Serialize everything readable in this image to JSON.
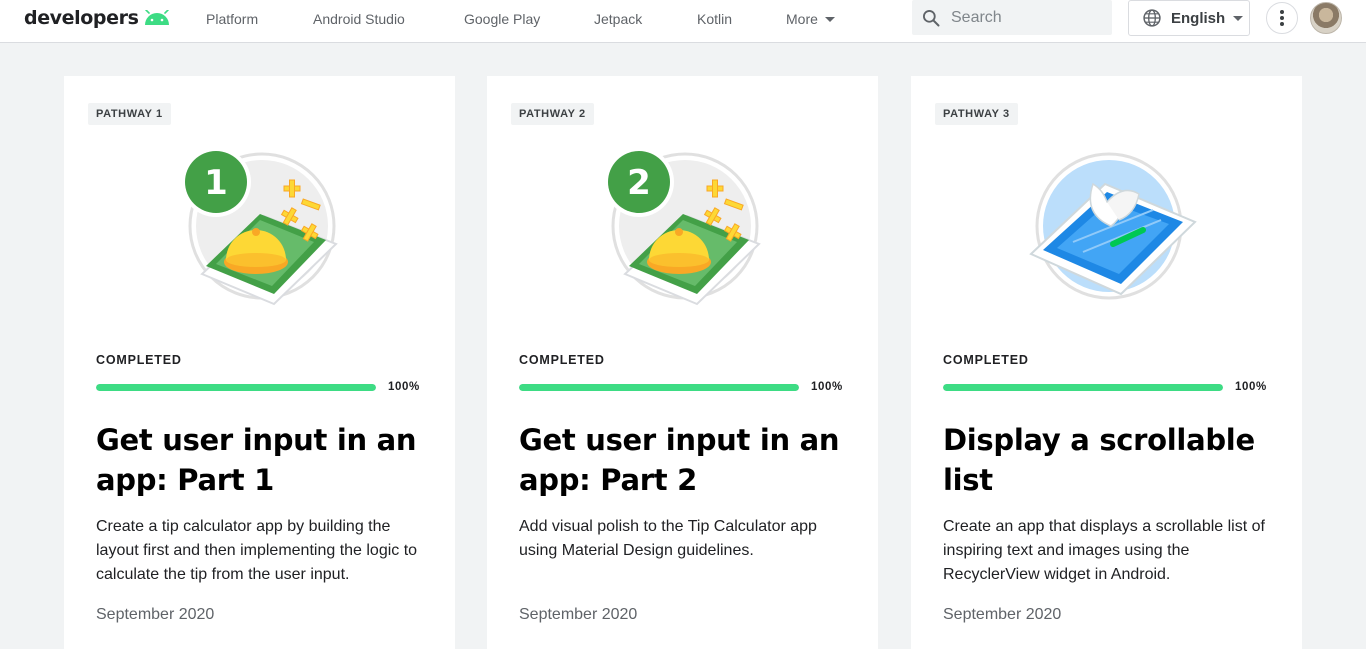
{
  "header": {
    "logo_text": "developers",
    "nav": [
      {
        "label": "Platform"
      },
      {
        "label": "Android Studio"
      },
      {
        "label": "Google Play"
      },
      {
        "label": "Jetpack"
      },
      {
        "label": "Kotlin"
      },
      {
        "label": "More"
      }
    ],
    "search": {
      "placeholder": "Search"
    },
    "language": "English"
  },
  "colors": {
    "accent_green": "#3ddc84",
    "badge_green": "#43a047",
    "bell_yellow": "#fbc02d",
    "background": "#f1f3f4"
  },
  "cards": [
    {
      "pathway": "PATHWAY 1",
      "badge_number": "1",
      "illustration": "tip-calculator-illustration",
      "status": "COMPLETED",
      "progress": 100,
      "progress_label": "100%",
      "title": "Get user input in an app: Part 1",
      "description": "Create a tip calculator app by building the layout first and then implementing the logic to calculate the tip from the user input.",
      "date": "September 2020"
    },
    {
      "pathway": "PATHWAY 2",
      "badge_number": "2",
      "illustration": "tip-calculator-illustration",
      "status": "COMPLETED",
      "progress": 100,
      "progress_label": "100%",
      "title": "Get user input in an app: Part 2",
      "description": "Add visual polish to the Tip Calculator app using Material Design guidelines.",
      "date": "September 2020"
    },
    {
      "pathway": "PATHWAY 3",
      "badge_number": "",
      "illustration": "scrollable-list-illustration",
      "status": "COMPLETED",
      "progress": 100,
      "progress_label": "100%",
      "title": "Display a scrollable list",
      "description": "Create an app that displays a scrollable list of inspiring text and images using the RecyclerView widget in Android.",
      "date": "September 2020"
    }
  ]
}
